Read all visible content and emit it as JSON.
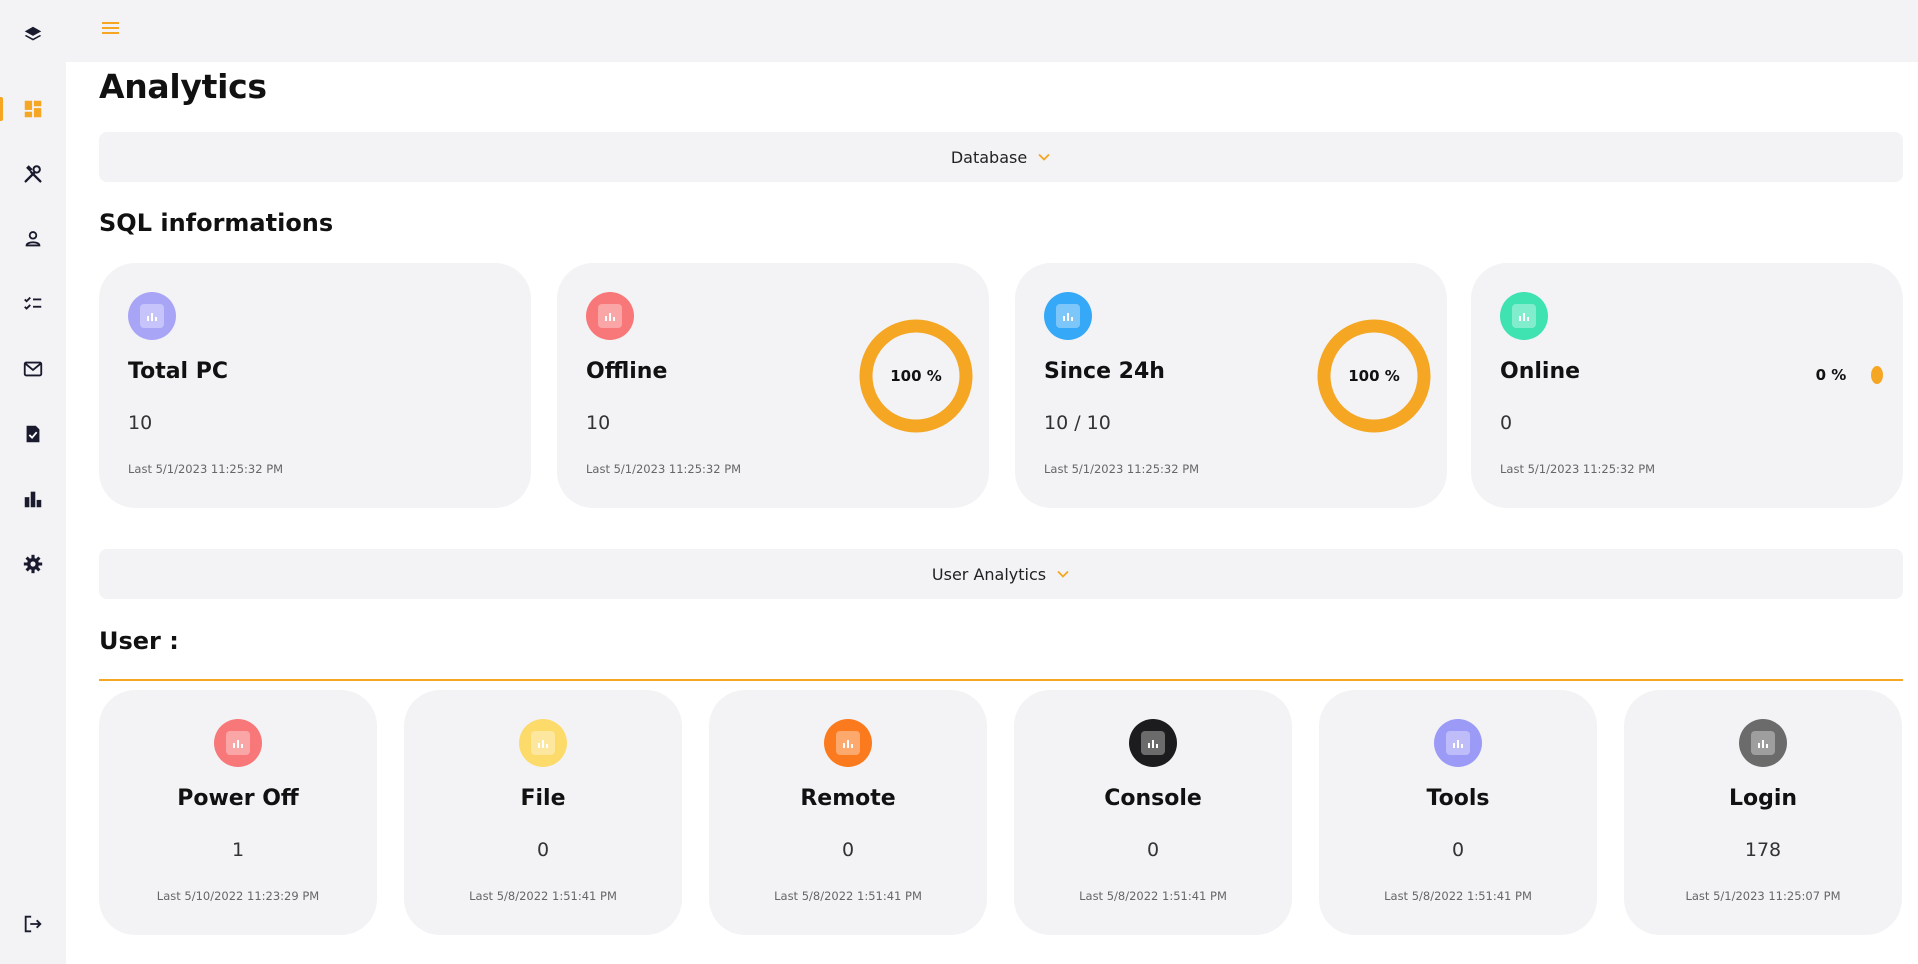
{
  "page": {
    "title": "Analytics"
  },
  "sidebar": {
    "icons": [
      "layers-icon",
      "dashboard-icon",
      "tools-icon",
      "user-icon",
      "checklist-icon",
      "mail-icon",
      "file-check-icon",
      "bar-chart-icon",
      "settings-icon",
      "logout-icon"
    ],
    "active": "dashboard-icon"
  },
  "colors": {
    "accent": "#f5a623",
    "panel": "#f3f3f6"
  },
  "database_accordion": {
    "label": "Database"
  },
  "sql": {
    "title": "SQL informations",
    "cards": [
      {
        "name": "Total PC",
        "value": "10",
        "last": "Last 5/1/2023 11:25:32 PM",
        "icon_color": "#a8a5f7"
      },
      {
        "name": "Offline",
        "value": "10",
        "last": "Last 5/1/2023 11:25:32 PM",
        "icon_color": "#f87779",
        "percent_label": "100 %",
        "percent": 100
      },
      {
        "name": "Since 24h",
        "value": "10 / 10",
        "last": "Last 5/1/2023 11:25:32 PM",
        "icon_color": "#36a8f8",
        "percent_label": "100 %",
        "percent": 100
      },
      {
        "name": "Online",
        "value": "0",
        "last": "Last 5/1/2023 11:25:32 PM",
        "icon_color": "#3ee3b1",
        "percent_label": "0 %",
        "percent": 0
      }
    ]
  },
  "user_accordion": {
    "label": "User Analytics"
  },
  "user": {
    "title": "User :",
    "cards": [
      {
        "name": "Power Off",
        "value": "1",
        "last": "Last 5/10/2022 11:23:29 PM",
        "icon_color": "#f87779"
      },
      {
        "name": "File",
        "value": "0",
        "last": "Last 5/8/2022 1:51:41 PM",
        "icon_color": "#fcdb6b"
      },
      {
        "name": "Remote",
        "value": "0",
        "last": "Last 5/8/2022 1:51:41 PM",
        "icon_color": "#fc7a1e"
      },
      {
        "name": "Console",
        "value": "0",
        "last": "Last 5/8/2022 1:51:41 PM",
        "icon_color": "#1c1c1e"
      },
      {
        "name": "Tools",
        "value": "0",
        "last": "Last 5/8/2022 1:51:41 PM",
        "icon_color": "#9b9af7"
      },
      {
        "name": "Login",
        "value": "178",
        "last": "Last 5/1/2023 11:25:07 PM",
        "icon_color": "#6b6b6b"
      }
    ]
  }
}
